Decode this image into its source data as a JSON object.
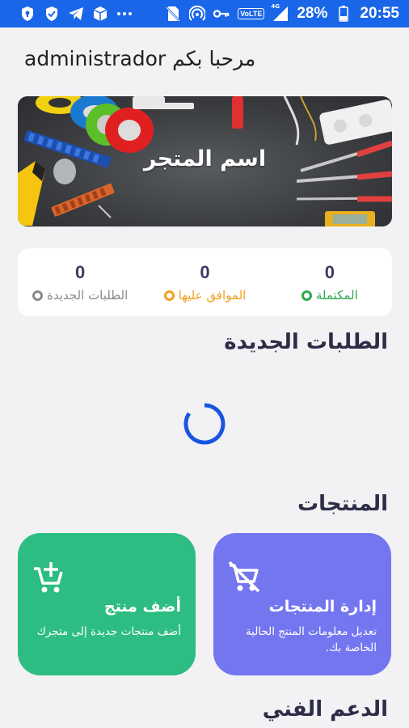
{
  "status_bar": {
    "battery": "28%",
    "time": "20:55",
    "volte": "VoLTE",
    "network": "4G",
    "icons": [
      "shield-icon",
      "shield-check-icon",
      "telegram-icon",
      "box-icon",
      "more-icon",
      "sim-off-icon",
      "hotspot-icon",
      "key-icon",
      "volte-icon",
      "signal-icon",
      "battery-icon"
    ]
  },
  "greeting": "مرحبا بكم administrador",
  "banner": {
    "title": "اسم المتجر"
  },
  "stats": [
    {
      "value": "0",
      "label": "المكتملة",
      "color": "#2fa84f"
    },
    {
      "value": "0",
      "label": "الموافق عليها",
      "color": "#f0a020"
    },
    {
      "value": "0",
      "label": "الطلبات الجديدة",
      "color": "#8a8a8a"
    }
  ],
  "sections": {
    "new_orders": "الطلبات الجديدة",
    "products": "المنتجات",
    "support": "الدعم الفني"
  },
  "cards": {
    "manage": {
      "title": "إدارة المنتجات",
      "desc": "تعديل معلومات المنتج الحالية الخاصة بك.",
      "color": "#7476f0"
    },
    "add": {
      "title": "أضف منتج",
      "desc": "أضف منتجات جديدة إلى متجرك",
      "color": "#2dbd82"
    }
  }
}
